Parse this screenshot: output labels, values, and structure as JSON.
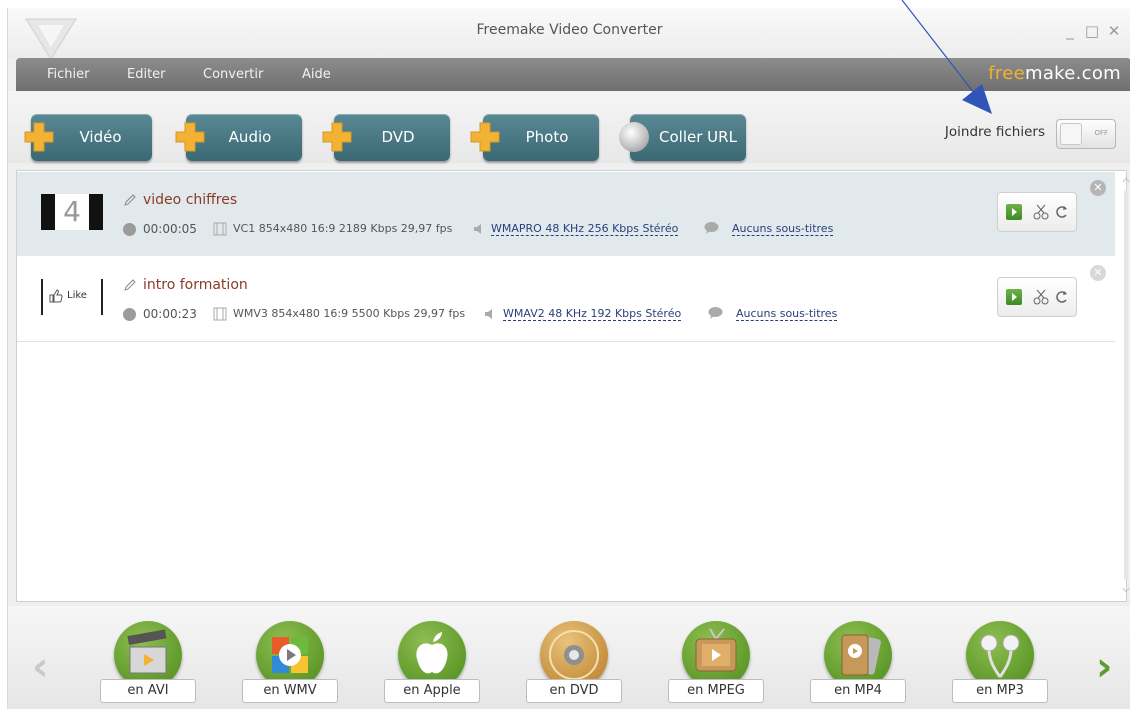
{
  "window": {
    "title": "Freemake Video Converter",
    "controls": {
      "minimize": "_",
      "maximize": "□",
      "close": "✕"
    }
  },
  "menu": {
    "items": [
      "Fichier",
      "Editer",
      "Convertir",
      "Aide"
    ],
    "brand_prefix": "free",
    "brand_suffix": "make.com"
  },
  "toolbar": {
    "buttons": [
      "Vidéo",
      "Audio",
      "DVD",
      "Photo",
      "Coller URL"
    ],
    "join_label": "Joindre fichiers",
    "toggle_state": "OFF"
  },
  "files": [
    {
      "name": "video chiffres",
      "duration": "00:00:05",
      "video": "VC1 854x480 16:9 2189 Kbps 29,97 fps",
      "audio": "WMAPRO 48 KHz 256 Kbps Stéréo",
      "subtitles": "Aucuns sous-titres",
      "thumb_text": "4",
      "selected": true
    },
    {
      "name": "intro formation",
      "duration": "00:00:23",
      "video": "WMV3 854x480 16:9 5500 Kbps 29,97 fps",
      "audio": "WMAV2 48 KHz 192 Kbps Stéréo",
      "subtitles": "Aucuns sous-titres",
      "thumb_text": "Like",
      "selected": false
    }
  ],
  "formats": [
    "en AVI",
    "en WMV",
    "en Apple",
    "en DVD",
    "en MPEG",
    "en MP4",
    "en MP3"
  ],
  "colors": {
    "accent_orange": "#f2b233",
    "button_teal": "#4a7a85",
    "format_green": "#5f9a2a",
    "annotation_blue": "#2f55b8"
  }
}
